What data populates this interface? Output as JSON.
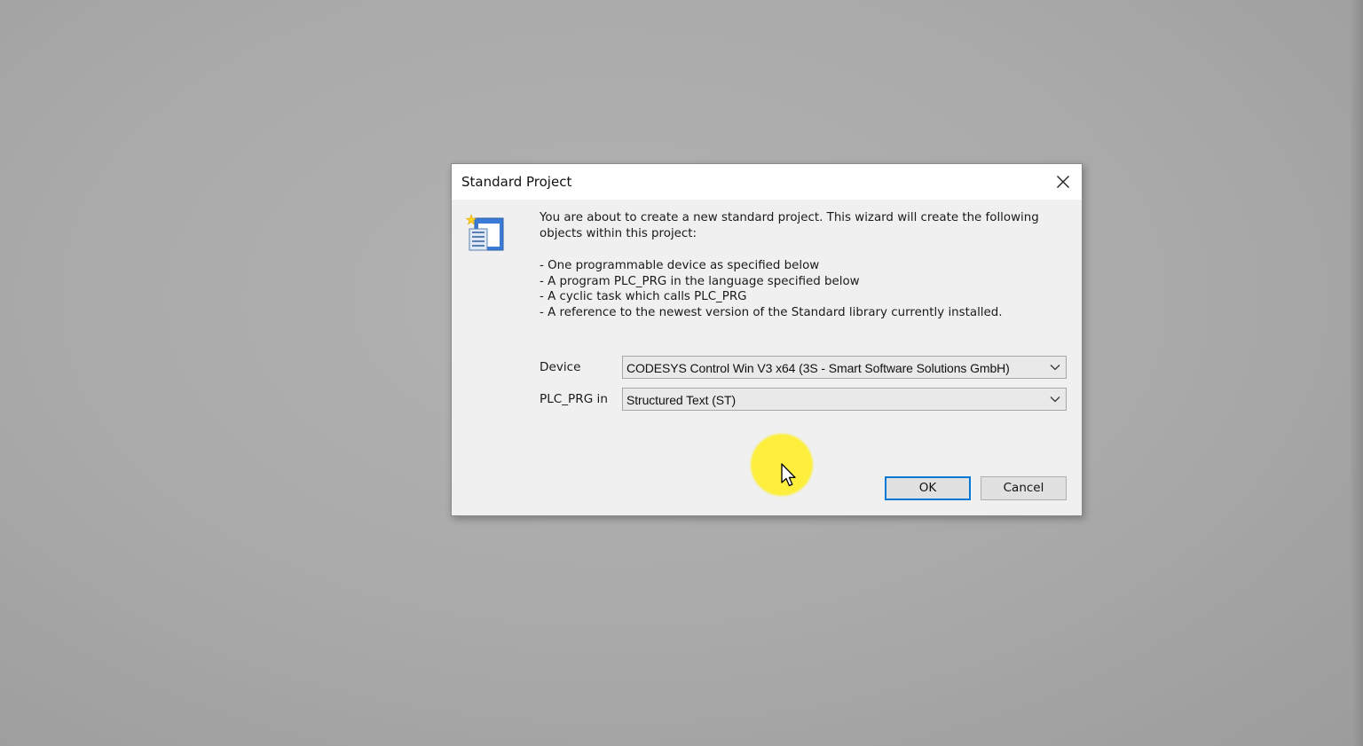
{
  "dialog": {
    "title": "Standard Project",
    "close_icon": "close-icon",
    "wizard_icon": "new-project-wizard-icon",
    "intro": "You are about to create a new standard project. This wizard will create the following objects within this project:",
    "bullets": [
      "- One programmable device as specified below",
      "- A program PLC_PRG in the language specified below",
      "- A cyclic task which calls PLC_PRG",
      "- A reference to the newest version of the Standard library currently installed."
    ],
    "device": {
      "label": "Device",
      "value": "CODESYS Control Win V3 x64 (3S - Smart Software Solutions GmbH)"
    },
    "language": {
      "label": "PLC_PRG in",
      "value": "Structured Text (ST)"
    },
    "ok_label": "OK",
    "cancel_label": "Cancel"
  },
  "colors": {
    "accent": "#0078d7",
    "cursor_highlight": "#ffee14",
    "dialog_background": "#f0f0f0",
    "desktop_background": "#aaaaaa"
  }
}
